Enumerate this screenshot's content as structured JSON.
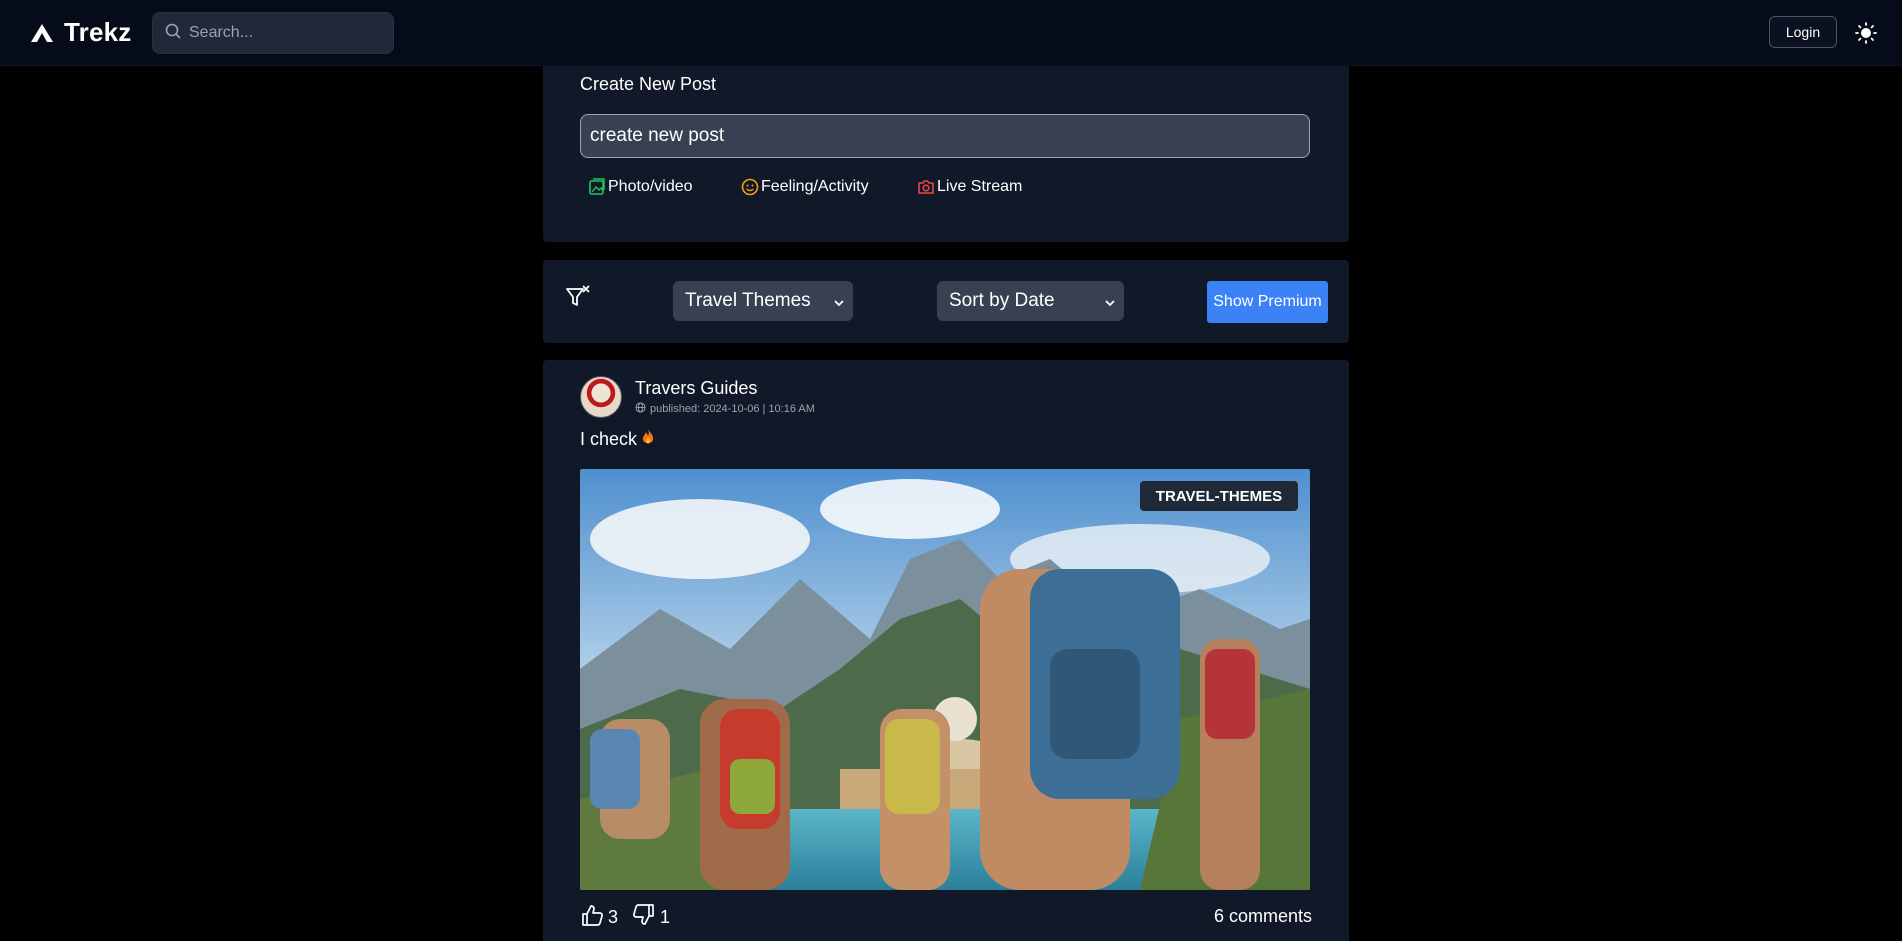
{
  "header": {
    "brand_name": "Trekz",
    "search_placeholder": "Search...",
    "login_label": "Login"
  },
  "create_post": {
    "title": "Create New Post",
    "input_placeholder": "create new post",
    "actions": {
      "photo_video": "Photo/video",
      "feeling_activity": "Feeling/Activity",
      "live_stream": "Live Stream"
    }
  },
  "filters": {
    "category_selected": "Travel Themes",
    "sort_selected": "Sort by Date",
    "premium_label": "Show Premium"
  },
  "post": {
    "author": "Travers Guides",
    "meta": "published: 2024-10-06 | 10:16 AM",
    "text": "I check",
    "tag": "TRAVEL-THEMES",
    "likes": "3",
    "dislikes": "1",
    "comments": "6 comments"
  },
  "colors": {
    "background": "#000000",
    "card": "#111827",
    "accent": "#3b82f6",
    "photo_icon": "#22c55e",
    "feeling_icon": "#f59e0b",
    "live_icon": "#ef4444"
  },
  "icons": {
    "brand": "trekz-logo-icon",
    "search": "search-icon",
    "theme": "sun-icon",
    "filter": "filter-clear-icon",
    "globe": "globe-icon",
    "like": "thumbs-up-icon",
    "dislike": "thumbs-down-icon",
    "fire": "fire-icon"
  }
}
